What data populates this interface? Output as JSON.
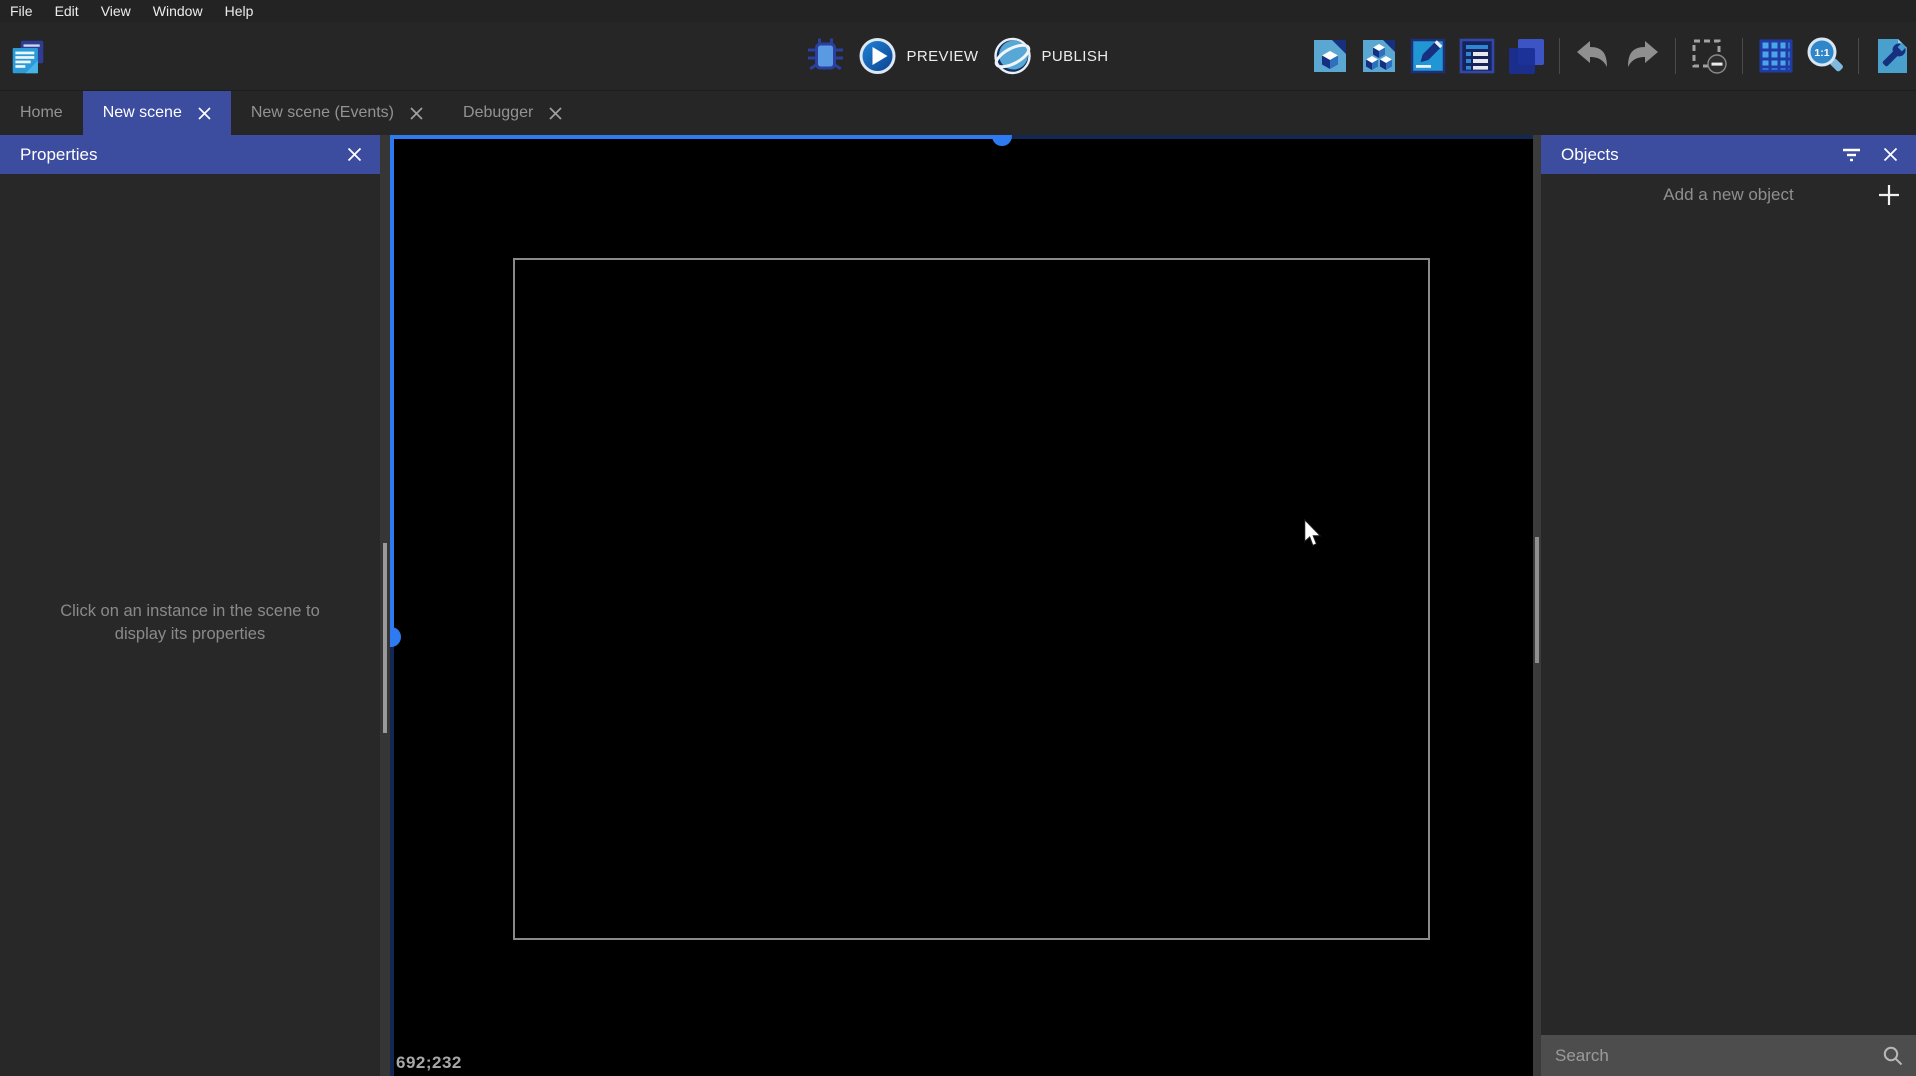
{
  "menu": {
    "items": [
      "File",
      "Edit",
      "View",
      "Window",
      "Help"
    ]
  },
  "toolbar": {
    "preview_label": "PREVIEW",
    "publish_label": "PUBLISH",
    "zoom_icon_label": "1:1",
    "icon_names": [
      "project-manager-logo",
      "debugger-bug",
      "preview-play",
      "publish-globe",
      "export-object",
      "object-groups",
      "edit-scene-properties",
      "layers-list",
      "instances-list",
      "undo",
      "redo",
      "edit-mask",
      "grid",
      "zoom-1-1",
      "project-settings-wrench"
    ]
  },
  "tabs": [
    {
      "label": "Home",
      "active": false,
      "closable": false
    },
    {
      "label": "New scene",
      "active": true,
      "closable": true
    },
    {
      "label": "New scene (Events)",
      "active": false,
      "closable": true
    },
    {
      "label": "Debugger",
      "active": false,
      "closable": true
    }
  ],
  "properties_panel": {
    "title": "Properties",
    "empty_message": "Click on an instance in the scene to display its properties"
  },
  "objects_panel": {
    "title": "Objects",
    "add_button_label": "Add a new object",
    "search_placeholder": "Search"
  },
  "scene_canvas": {
    "cursor_coordinates": "692;232"
  },
  "colors": {
    "accent_blue": "#2e7af0",
    "track_navy": "#132850",
    "header_indigo": "#3c4c9f",
    "active_tab": "#3c4c9f",
    "canvas": "#000000",
    "panel_bg": "#282828",
    "toolbar_bg": "#262626",
    "search_bg": "#4d4d4d",
    "frame_border": "#8a8a8a"
  }
}
